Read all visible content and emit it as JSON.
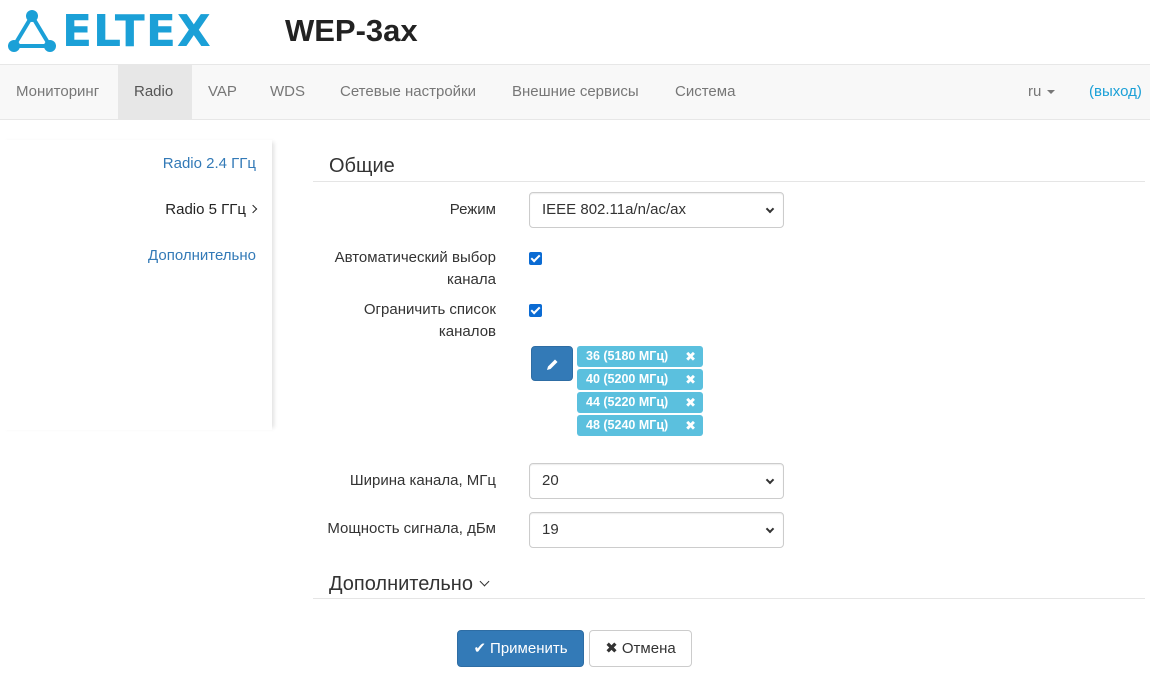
{
  "header": {
    "logo_text": "ELTEX",
    "device_title": "WEP-3ax",
    "brand_color": "#1ba0d7"
  },
  "nav": {
    "items": [
      {
        "label": "Мониторинг",
        "active": false
      },
      {
        "label": "Radio",
        "active": true
      },
      {
        "label": "VAP",
        "active": false
      },
      {
        "label": "WDS",
        "active": false
      },
      {
        "label": "Сетевые настройки",
        "active": false
      },
      {
        "label": "Внешние сервисы",
        "active": false
      },
      {
        "label": "Система",
        "active": false
      }
    ],
    "language": "ru",
    "logout": "(выход)"
  },
  "sidebar": {
    "items": [
      {
        "label": "Radio 2.4 ГГц",
        "active": false
      },
      {
        "label": "Radio 5 ГГц",
        "active": true
      },
      {
        "label": "Дополнительно",
        "active": false
      }
    ]
  },
  "general": {
    "title": "Общие",
    "mode_label": "Режим",
    "mode_value": "IEEE 802.11a/n/ac/ax",
    "auto_channel_label_1": "Автоматический выбор",
    "auto_channel_label_2": "канала",
    "auto_channel_checked": true,
    "limit_channels_label_1": "Ограничить список",
    "limit_channels_label_2": "каналов",
    "limit_channels_checked": true,
    "channels": [
      "36 (5180 МГц)",
      "40 (5200 МГц)",
      "44 (5220 МГц)",
      "48 (5240 МГц)"
    ],
    "bandwidth_label": "Ширина канала, МГц",
    "bandwidth_value": "20",
    "power_label": "Мощность сигнала, дБм",
    "power_value": "19"
  },
  "advanced": {
    "title": "Дополнительно"
  },
  "actions": {
    "apply_label": "Применить",
    "cancel_label": "Отмена"
  },
  "icons": {
    "edit": "pencil-icon",
    "remove": "close-icon",
    "apply": "check-icon",
    "cancel": "close-icon"
  }
}
